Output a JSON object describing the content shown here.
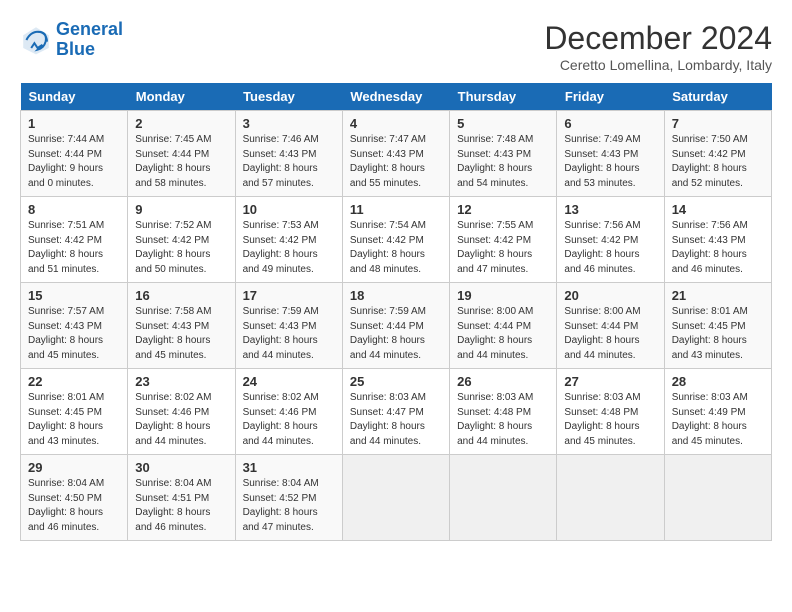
{
  "logo": {
    "line1": "General",
    "line2": "Blue"
  },
  "title": "December 2024",
  "subtitle": "Ceretto Lomellina, Lombardy, Italy",
  "weekdays": [
    "Sunday",
    "Monday",
    "Tuesday",
    "Wednesday",
    "Thursday",
    "Friday",
    "Saturday"
  ],
  "weeks": [
    [
      {
        "day": "1",
        "sunrise": "7:44 AM",
        "sunset": "4:44 PM",
        "daylight": "9 hours and 0 minutes."
      },
      {
        "day": "2",
        "sunrise": "7:45 AM",
        "sunset": "4:44 PM",
        "daylight": "8 hours and 58 minutes."
      },
      {
        "day": "3",
        "sunrise": "7:46 AM",
        "sunset": "4:43 PM",
        "daylight": "8 hours and 57 minutes."
      },
      {
        "day": "4",
        "sunrise": "7:47 AM",
        "sunset": "4:43 PM",
        "daylight": "8 hours and 55 minutes."
      },
      {
        "day": "5",
        "sunrise": "7:48 AM",
        "sunset": "4:43 PM",
        "daylight": "8 hours and 54 minutes."
      },
      {
        "day": "6",
        "sunrise": "7:49 AM",
        "sunset": "4:43 PM",
        "daylight": "8 hours and 53 minutes."
      },
      {
        "day": "7",
        "sunrise": "7:50 AM",
        "sunset": "4:42 PM",
        "daylight": "8 hours and 52 minutes."
      }
    ],
    [
      {
        "day": "8",
        "sunrise": "7:51 AM",
        "sunset": "4:42 PM",
        "daylight": "8 hours and 51 minutes."
      },
      {
        "day": "9",
        "sunrise": "7:52 AM",
        "sunset": "4:42 PM",
        "daylight": "8 hours and 50 minutes."
      },
      {
        "day": "10",
        "sunrise": "7:53 AM",
        "sunset": "4:42 PM",
        "daylight": "8 hours and 49 minutes."
      },
      {
        "day": "11",
        "sunrise": "7:54 AM",
        "sunset": "4:42 PM",
        "daylight": "8 hours and 48 minutes."
      },
      {
        "day": "12",
        "sunrise": "7:55 AM",
        "sunset": "4:42 PM",
        "daylight": "8 hours and 47 minutes."
      },
      {
        "day": "13",
        "sunrise": "7:56 AM",
        "sunset": "4:42 PM",
        "daylight": "8 hours and 46 minutes."
      },
      {
        "day": "14",
        "sunrise": "7:56 AM",
        "sunset": "4:43 PM",
        "daylight": "8 hours and 46 minutes."
      }
    ],
    [
      {
        "day": "15",
        "sunrise": "7:57 AM",
        "sunset": "4:43 PM",
        "daylight": "8 hours and 45 minutes."
      },
      {
        "day": "16",
        "sunrise": "7:58 AM",
        "sunset": "4:43 PM",
        "daylight": "8 hours and 45 minutes."
      },
      {
        "day": "17",
        "sunrise": "7:59 AM",
        "sunset": "4:43 PM",
        "daylight": "8 hours and 44 minutes."
      },
      {
        "day": "18",
        "sunrise": "7:59 AM",
        "sunset": "4:44 PM",
        "daylight": "8 hours and 44 minutes."
      },
      {
        "day": "19",
        "sunrise": "8:00 AM",
        "sunset": "4:44 PM",
        "daylight": "8 hours and 44 minutes."
      },
      {
        "day": "20",
        "sunrise": "8:00 AM",
        "sunset": "4:44 PM",
        "daylight": "8 hours and 44 minutes."
      },
      {
        "day": "21",
        "sunrise": "8:01 AM",
        "sunset": "4:45 PM",
        "daylight": "8 hours and 43 minutes."
      }
    ],
    [
      {
        "day": "22",
        "sunrise": "8:01 AM",
        "sunset": "4:45 PM",
        "daylight": "8 hours and 43 minutes."
      },
      {
        "day": "23",
        "sunrise": "8:02 AM",
        "sunset": "4:46 PM",
        "daylight": "8 hours and 44 minutes."
      },
      {
        "day": "24",
        "sunrise": "8:02 AM",
        "sunset": "4:46 PM",
        "daylight": "8 hours and 44 minutes."
      },
      {
        "day": "25",
        "sunrise": "8:03 AM",
        "sunset": "4:47 PM",
        "daylight": "8 hours and 44 minutes."
      },
      {
        "day": "26",
        "sunrise": "8:03 AM",
        "sunset": "4:48 PM",
        "daylight": "8 hours and 44 minutes."
      },
      {
        "day": "27",
        "sunrise": "8:03 AM",
        "sunset": "4:48 PM",
        "daylight": "8 hours and 45 minutes."
      },
      {
        "day": "28",
        "sunrise": "8:03 AM",
        "sunset": "4:49 PM",
        "daylight": "8 hours and 45 minutes."
      }
    ],
    [
      {
        "day": "29",
        "sunrise": "8:04 AM",
        "sunset": "4:50 PM",
        "daylight": "8 hours and 46 minutes."
      },
      {
        "day": "30",
        "sunrise": "8:04 AM",
        "sunset": "4:51 PM",
        "daylight": "8 hours and 46 minutes."
      },
      {
        "day": "31",
        "sunrise": "8:04 AM",
        "sunset": "4:52 PM",
        "daylight": "8 hours and 47 minutes."
      },
      null,
      null,
      null,
      null
    ]
  ]
}
